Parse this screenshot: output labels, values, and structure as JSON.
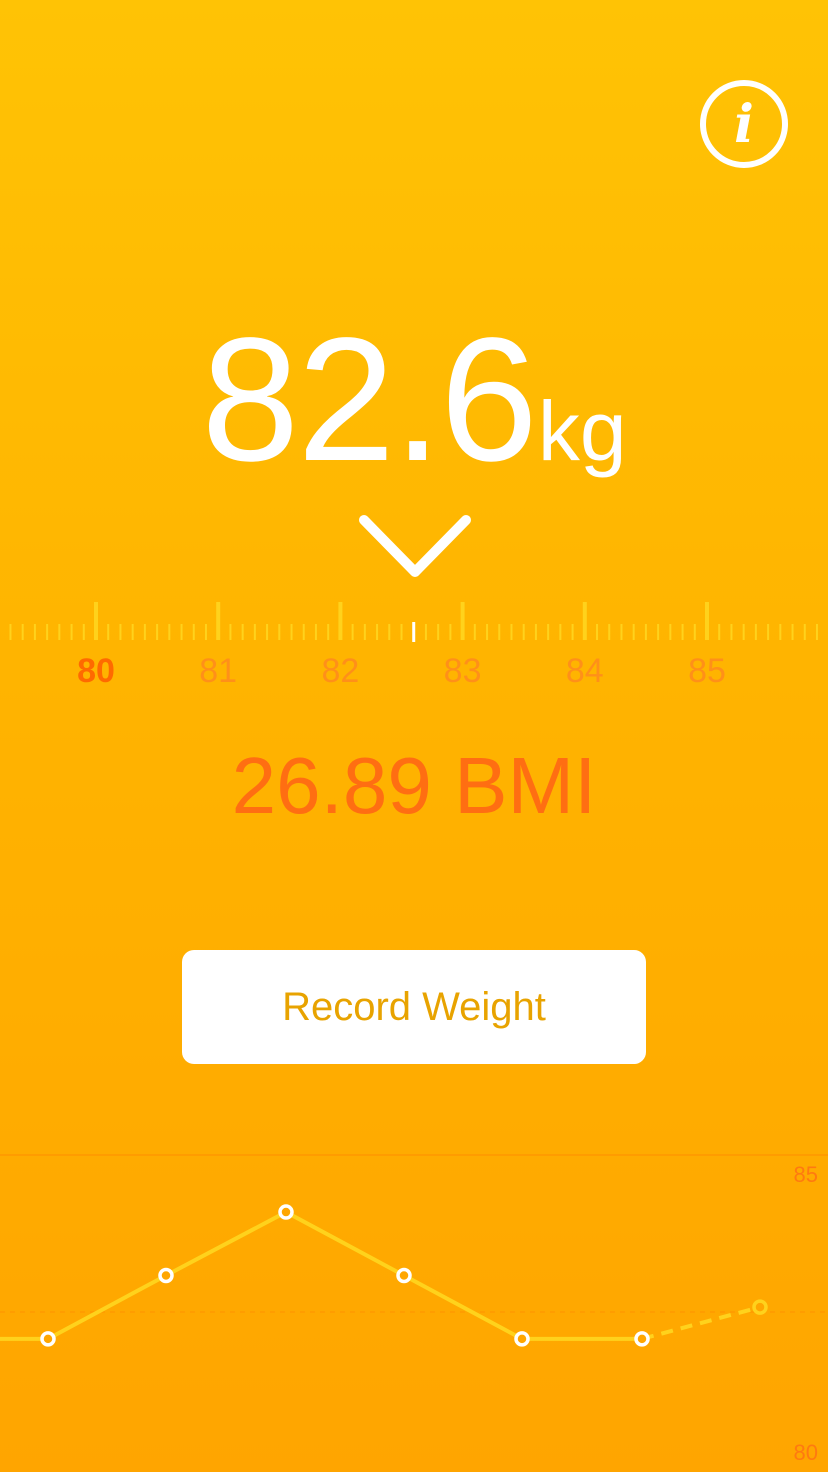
{
  "header": {
    "info_icon": "info-icon",
    "info_glyph": "i"
  },
  "weight": {
    "value": "82.6",
    "unit": "kg"
  },
  "ruler": {
    "min": 79.2,
    "max": 85.9,
    "selected": 82.6,
    "labels": [
      "80",
      "81",
      "82",
      "83",
      "84",
      "85"
    ],
    "active_label": "80"
  },
  "bmi": {
    "text": "26.89 BMI"
  },
  "record_button": {
    "label": "Record Weight"
  },
  "chart_data": {
    "type": "line",
    "ylim": [
      80,
      85
    ],
    "y_tick_labels": [
      "85",
      "80"
    ],
    "series": [
      {
        "values": [
          82.1,
          82.1,
          83.1,
          84.1,
          83.1,
          82.1,
          82.1
        ]
      },
      {
        "values": [
          82.1,
          82.6
        ],
        "style": "dashed"
      }
    ]
  },
  "colors": {
    "background_top": "#FFC305",
    "background_bottom": "#FFA500",
    "accent": "#FF6E12",
    "button_text": "#E8A300",
    "chart_line": "#FFD21C"
  }
}
